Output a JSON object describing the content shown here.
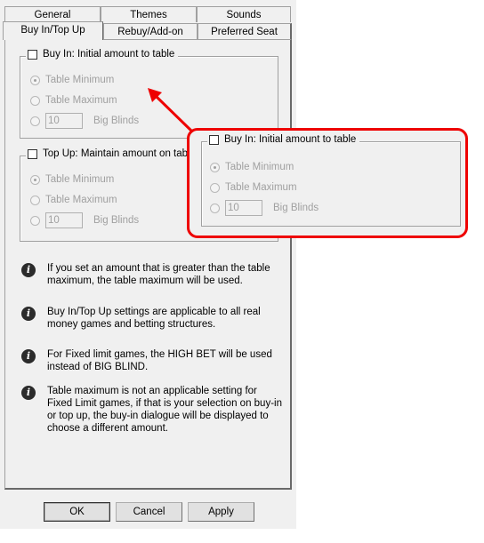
{
  "tabs_row1": [
    {
      "label": "General"
    },
    {
      "label": "Themes"
    },
    {
      "label": "Sounds"
    }
  ],
  "tabs_row2": [
    {
      "label": "Buy In/Top Up",
      "active": true
    },
    {
      "label": "Rebuy/Add-on"
    },
    {
      "label": "Preferred Seat"
    }
  ],
  "buy_in": {
    "checkbox_label": "Buy In: Initial amount to table",
    "checked": false,
    "options": [
      "Table Minimum",
      "Table Maximum"
    ],
    "selected": "Table Minimum",
    "big_blinds_value": "10",
    "big_blinds_label": "Big Blinds"
  },
  "top_up": {
    "checkbox_label": "Top Up: Maintain amount on table",
    "checked": false,
    "options": [
      "Table Minimum",
      "Table Maximum"
    ],
    "selected": "Table Minimum",
    "big_blinds_value": "10",
    "big_blinds_label": "Big Blinds"
  },
  "info_notes": [
    "If you set an amount that is greater than the table maximum, the table maximum will be used.",
    "Buy In/Top Up settings are applicable to all real money games and betting structures.",
    "For Fixed limit games, the HIGH BET will be used instead of BIG BLIND.",
    "Table maximum is not an applicable setting for Fixed Limit games, if that is your selection on buy-in or top up, the buy-in dialogue will be displayed to choose a different amount."
  ],
  "buttons": {
    "ok": "OK",
    "cancel": "Cancel",
    "apply": "Apply"
  },
  "callout": {
    "checkbox_label": "Buy In: Initial amount to table",
    "options": [
      "Table Minimum",
      "Table Maximum"
    ],
    "big_blinds_value": "10",
    "big_blinds_label": "Big Blinds",
    "highlight_color": "#ee0000"
  },
  "colors": {
    "dialog_bg": "#f0f0f0",
    "disabled_text": "#a0a0a0",
    "annotation": "#ee0000"
  }
}
